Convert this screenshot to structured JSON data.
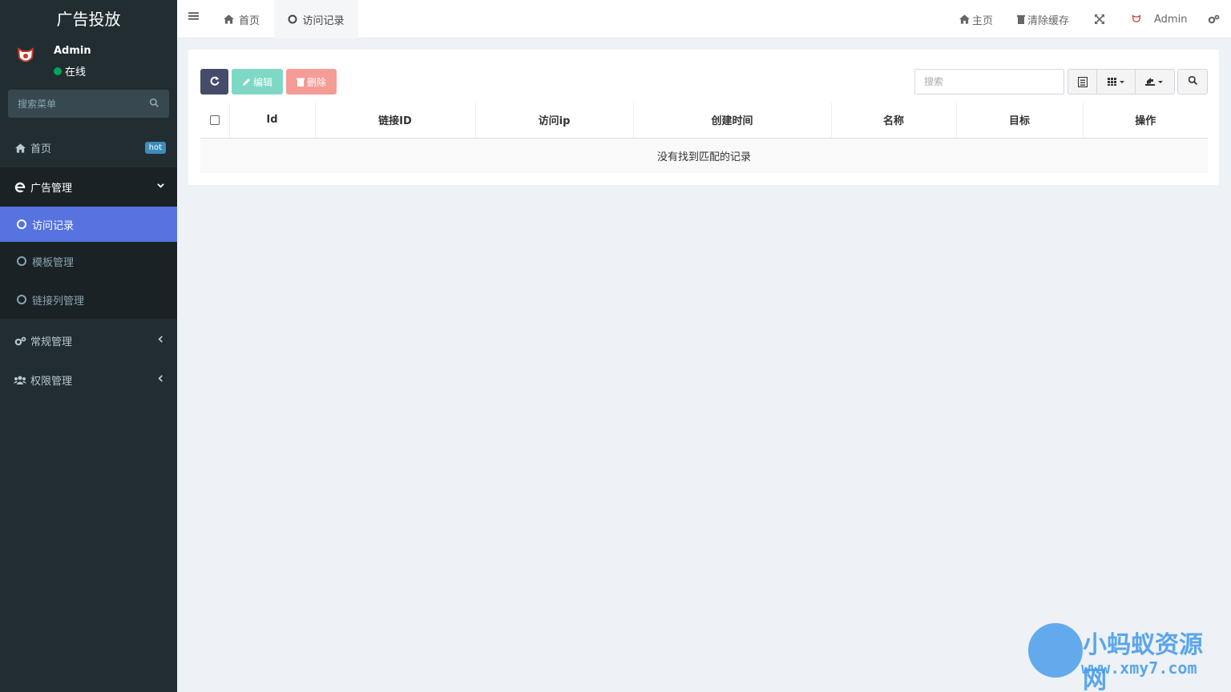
{
  "sidebar": {
    "logo": "广告投放",
    "user": {
      "name": "Admin",
      "status": "在线"
    },
    "search": {
      "placeholder": "搜索菜单"
    },
    "menu": {
      "home": {
        "label": "首页",
        "badge": "hot"
      },
      "ad_mgmt": {
        "label": "广告管理"
      },
      "sub": [
        {
          "label": "访问记录"
        },
        {
          "label": "模板管理"
        },
        {
          "label": "链接列管理"
        }
      ],
      "general": {
        "label": "常规管理"
      },
      "auth": {
        "label": "权限管理"
      }
    }
  },
  "topbar": {
    "tabs": [
      {
        "label": "首页"
      },
      {
        "label": "访问记录"
      }
    ],
    "right": {
      "home": "主页",
      "clear_cache": "清除缓存",
      "user": "Admin"
    }
  },
  "toolbar": {
    "edit": "编辑",
    "delete": "删除",
    "search_placeholder": "搜索"
  },
  "table": {
    "headers": [
      "Id",
      "链接ID",
      "访问ip",
      "创建时间",
      "名称",
      "目标",
      "操作"
    ],
    "empty_message": "没有找到匹配的记录"
  },
  "watermark": {
    "title": "小蚂蚁资源网",
    "url": "www.xmy7.com"
  },
  "colors": {
    "sidebar_bg": "#222d32",
    "active_item": "#5673e0",
    "refresh_btn": "#444c69",
    "edit_btn": "#7fd8c6",
    "delete_btn": "#f59c96",
    "online": "#00a65a",
    "hot_badge": "#3c8dbc"
  }
}
